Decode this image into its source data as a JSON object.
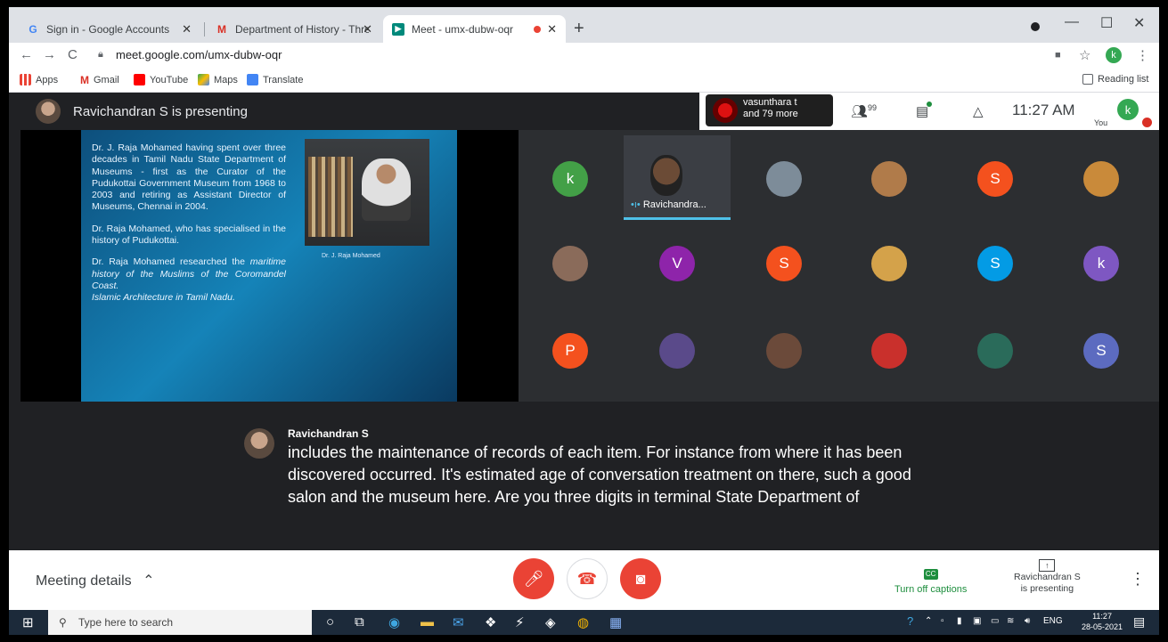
{
  "browser": {
    "tabs": [
      {
        "label": "Sign in - Google Accounts",
        "icon": "google-icon"
      },
      {
        "label": "Department of History - Three d",
        "icon": "gmail-icon"
      },
      {
        "label": "Meet - umx-dubw-oqr",
        "icon": "meet-icon",
        "active": true,
        "recording": true
      }
    ],
    "url": "meet.google.com/umx-dubw-oqr",
    "bookmarks": [
      "Apps",
      "Gmail",
      "YouTube",
      "Maps",
      "Translate"
    ],
    "reading_list": "Reading list",
    "profile_initial": "k"
  },
  "meet": {
    "presenting_title": "Ravichandran S is presenting",
    "viewer_info": {
      "line1": "vasunthara t",
      "line2": "and 79 more"
    },
    "people_badge": "99",
    "time": "11:27 AM",
    "you_label": "You",
    "you_initial": "k",
    "slide": {
      "paragraphs": [
        "Dr. J. Raja Mohamed having spent over three decades in Tamil Nadu State Department of Museums - first as the Curator of the Pudukottai Government Museum from 1968 to 2003 and retiring as Assistant Director of Museums, Chennai in 2004.",
        "Dr. Raja Mohamed, who has specialised in the history of Pudukottai."
      ],
      "para3_intro": "Dr. Raja Mohamed researched the",
      "para3_italic": "maritime history of the Muslims of the Coromandel Coast.",
      "para3_italic2": "Islamic Architecture in Tamil Nadu.",
      "photo_caption": "Dr. J. Raja Mohamed"
    },
    "presenter_tile_name": "Ravichandra...",
    "participants": [
      {
        "letter": "k",
        "color": "#43a047"
      },
      {
        "letter": "",
        "color": "#7d8c99"
      },
      {
        "letter": "",
        "color": "#b07b4a"
      },
      {
        "letter": "S",
        "color": "#f4511e"
      },
      {
        "letter": "",
        "color": "#c98a3a"
      },
      {
        "letter": "",
        "color": "#8a6b5a"
      },
      {
        "letter": "V",
        "color": "#8e24aa"
      },
      {
        "letter": "S",
        "color": "#f4511e"
      },
      {
        "letter": "",
        "color": "#d4a24a"
      },
      {
        "letter": "S",
        "color": "#039be5"
      },
      {
        "letter": "k",
        "color": "#7e57c2"
      },
      {
        "letter": "P",
        "color": "#f4511e"
      },
      {
        "letter": "",
        "color": "#5a4a8a"
      },
      {
        "letter": "",
        "color": "#6b4a3a"
      },
      {
        "letter": "",
        "color": "#c9302c"
      },
      {
        "letter": "",
        "color": "#2a6b5a"
      },
      {
        "letter": "S",
        "color": "#5c6bc0"
      }
    ],
    "caption": {
      "speaker": "Ravichandran S",
      "text": "includes the maintenance of records of each item. For instance from where it has been discovered occurred. It's estimated age of conversation treatment on there, such a good salon and the museum here. Are you three digits in terminal State Department of"
    },
    "bottom": {
      "meeting_details": "Meeting details",
      "captions_label": "Turn off captions",
      "presenting_line1": "Ravichandran S",
      "presenting_line2": "is presenting"
    }
  },
  "taskbar": {
    "search_placeholder": "Type here to search",
    "lang": "ENG",
    "time": "11:27",
    "date": "28-05-2021"
  }
}
